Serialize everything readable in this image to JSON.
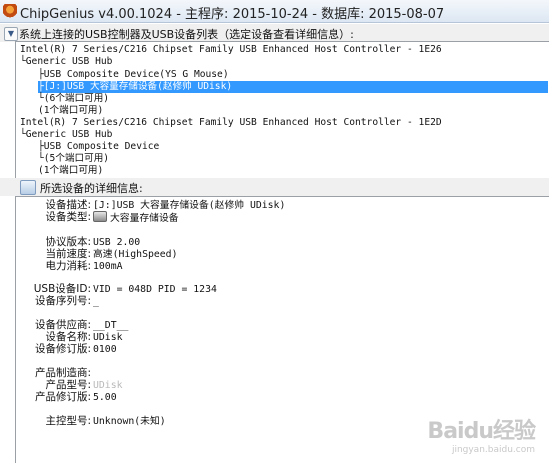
{
  "window": {
    "title": "ChipGenius v4.00.1024 - 主程序: 2015-10-24 - 数据库: 2015-08-07",
    "app_icon": "chipgenius-app-icon"
  },
  "tree_section": {
    "header": "系统上连接的USB控制器及USB设备列表（选定设备查看详细信息）:",
    "nodes": [
      {
        "text": "Intel(R) 7 Series/C216 Chipset Family USB Enhanced Host Controller - 1E26"
      },
      {
        "text": "└Generic USB Hub"
      },
      {
        "text": "├USB Composite Device(YS G Mouse)"
      },
      {
        "text": "├[J:]USB 大容量存储设备(赵修帅 UDisk)"
      },
      {
        "text": "└(6个端口可用)"
      },
      {
        "text": "(1个端口可用)"
      },
      {
        "text": "Intel(R) 7 Series/C216 Chipset Family USB Enhanced Host Controller - 1E2D"
      },
      {
        "text": "└Generic USB Hub"
      },
      {
        "text": "├USB Composite Device"
      },
      {
        "text": "└(5个端口可用)"
      },
      {
        "text": "(1个端口可用)"
      }
    ]
  },
  "detail_section": {
    "header": "所选设备的详细信息:",
    "rows": [
      {
        "label": "设备描述:",
        "value": "[J:]USB 大容量存储设备(赵修帅 UDisk)"
      },
      {
        "label": "设备类型:",
        "value": "大容量存储设备"
      },
      {
        "label": "协议版本:",
        "value": "USB 2.00"
      },
      {
        "label": "当前速度:",
        "value": "高速(HighSpeed)"
      },
      {
        "label": "电力消耗:",
        "value": "100mA"
      },
      {
        "label": "USB设备ID:",
        "value": "VID = 048D PID = 1234"
      },
      {
        "label": "设备序列号:",
        "value": "_"
      },
      {
        "label": "设备供应商:",
        "value": "__DT__"
      },
      {
        "label": "设备名称:",
        "value": "UDisk"
      },
      {
        "label": "设备修订版:",
        "value": "0100"
      },
      {
        "label": "产品制造商:",
        "value": ""
      },
      {
        "label": "产品型号:",
        "value": "UDisk"
      },
      {
        "label": "产品修订版:",
        "value": "5.00"
      },
      {
        "label": "主控型号:",
        "value": "Unknown(未知)"
      }
    ]
  },
  "watermark": {
    "text": "Baidu经验",
    "sub": "jingyan.baidu.com"
  }
}
